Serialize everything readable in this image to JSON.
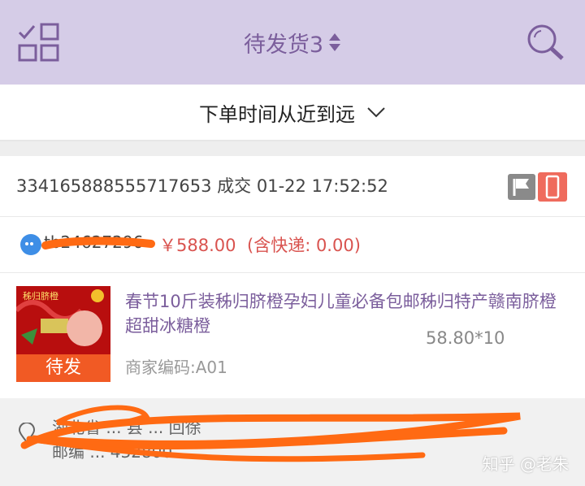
{
  "header": {
    "title": "待发货3"
  },
  "sort": {
    "label": "下单时间从近到远"
  },
  "order": {
    "number_and_time": "334165888555717653 成交 01-22 17:52:52",
    "buyer_id": "tb24627296",
    "price": "￥588.00",
    "shipping": "(含快递: 0.00)"
  },
  "product": {
    "title": "春节10斤装秭归脐橙孕妇儿童必备包邮秭归特产赣南脐橙超甜冰糖橙",
    "qty": "58.80*10",
    "sku": "商家编码:A01",
    "status": "待发",
    "brand_text": "秭归脐橙"
  },
  "address": {
    "line1": "湖北省 ... 县 ... 回徐",
    "line2": "邮编 ... 432800"
  },
  "watermark": "知乎 @老朱",
  "colors": {
    "accent": "#7b5e9c",
    "topbar": "#d5cce7",
    "price": "#d9534f",
    "status_bg": "#f15a24"
  }
}
